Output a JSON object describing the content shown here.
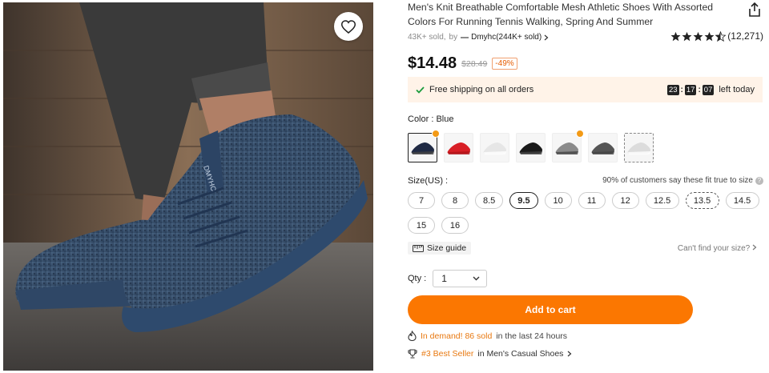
{
  "product": {
    "title": "Men's Knit Breathable Comfortable Mesh Athletic Shoes With Assorted Colors For Running Tennis Walking, Spring And Summer",
    "sold": "43K+ sold,",
    "by": "by",
    "store": "Dmyhc(244K+ sold)",
    "rating_count": "(12,271)",
    "rating_value": 4.5,
    "price": "$14.48",
    "orig_price": "$28.49",
    "discount": "-49%",
    "shoe_brand_text": "DMYHC"
  },
  "shipping": {
    "text": "Free shipping on all orders",
    "hours": "23",
    "minutes": "17",
    "seconds": "07",
    "sep": ":",
    "suffix": "left today"
  },
  "color": {
    "label": "Color : Blue",
    "swatches": [
      {
        "name": "navy",
        "color": "#1f2a44",
        "selected": true,
        "hot": true
      },
      {
        "name": "red",
        "color": "#d81f26"
      },
      {
        "name": "white",
        "color": "#e6e6e6"
      },
      {
        "name": "black",
        "color": "#1a1a1a"
      },
      {
        "name": "grey",
        "color": "#8a8a8a",
        "hot": true
      },
      {
        "name": "dark-grey",
        "color": "#555555"
      },
      {
        "name": "light",
        "color": "#dcdcdc",
        "dashed": true
      }
    ]
  },
  "size": {
    "label": "Size(US) :",
    "fit_note": "90% of customers say these fit true to size",
    "options": [
      "7",
      "8",
      "8.5",
      "9.5",
      "10",
      "11",
      "12",
      "12.5",
      "13.5",
      "14.5",
      "15",
      "16"
    ],
    "selected": "9.5",
    "dashed": "13.5",
    "guide": "Size guide",
    "cant_find": "Can't find your size?"
  },
  "qty": {
    "label": "Qty :",
    "value": "1"
  },
  "cart": {
    "label": "Add to cart"
  },
  "demand": {
    "prefix": "In demand! 86 sold",
    "suffix": "in the last 24 hours"
  },
  "best": {
    "rank": "#3 Best Seller",
    "suffix": "in Men's Casual Shoes"
  },
  "icons": {
    "favorite": "heart-icon",
    "share": "share-icon",
    "store": "store-logo-icon",
    "check": "check-icon",
    "ruler": "ruler-icon",
    "fire": "flame-icon",
    "trophy": "trophy-icon"
  },
  "colors": {
    "accent": "#fb7701",
    "ship_bg": "#fff3e8",
    "orange_text": "#e8780f"
  }
}
